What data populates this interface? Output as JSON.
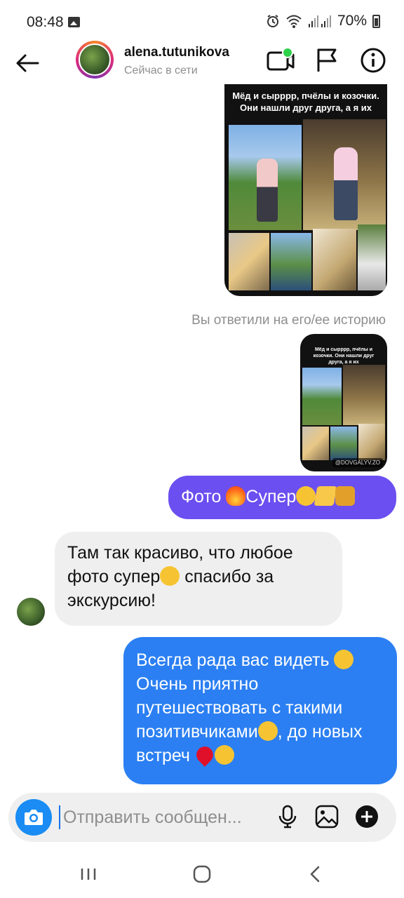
{
  "status_bar": {
    "time": "08:48",
    "battery": "70%"
  },
  "header": {
    "username": "alena.tutunikova",
    "presence": "Сейчас в сети"
  },
  "story_large": {
    "caption": "Мёд и сырррр, пчёлы и козочки. Они нашли друг друга, а я их"
  },
  "story_small": {
    "caption": "Мёд и сырррр, пчёлы и козочки. Они нашли друг друга, а я их",
    "watermark": "@DOVGALYV.ZO"
  },
  "replied_note": "Вы ответили на его/ее историю",
  "messages": [
    {
      "direction": "outgoing",
      "text_parts": [
        "Фото ",
        "Супер"
      ]
    },
    {
      "direction": "incoming",
      "text_parts": [
        "Там так красиво, что любое фото супер",
        " спасибо за экскурсию!"
      ]
    },
    {
      "direction": "outgoing",
      "text_parts": [
        "Всегда рада вас видеть ",
        "Очень приятно путешествовать с такими позитивчиками",
        ", до новых встреч "
      ]
    }
  ],
  "composer": {
    "placeholder": "Отправить сообщен..."
  },
  "colors": {
    "outgoing_purple": "#6b4ff0",
    "outgoing_blue": "#2b7ff2",
    "incoming_gray": "#efefef",
    "camera_blue": "#1a8cf4"
  }
}
